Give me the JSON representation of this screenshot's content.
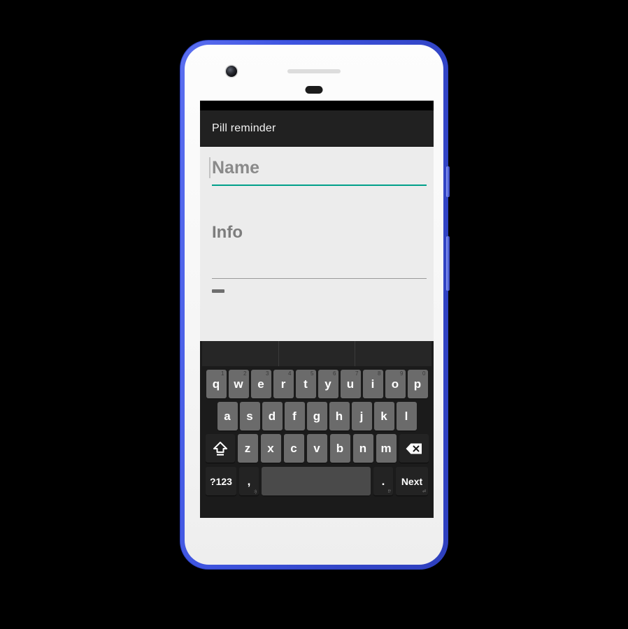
{
  "device": {
    "name": "android-phone-mockup",
    "frame_color": "#3b53d8",
    "body_color": "#f7f7f7",
    "camera": "front-camera",
    "earpiece": "earpiece-speaker",
    "sensor": "proximity-sensor"
  },
  "app": {
    "title": "Pill reminder",
    "app_bar_color": "#212121",
    "content_bg": "#ececec",
    "accent_color": "#00a08a"
  },
  "form": {
    "name_field": {
      "placeholder": "Name",
      "value": "",
      "focused": true,
      "underline_color": "#00a08a"
    },
    "info_field": {
      "placeholder": "Info",
      "value": "",
      "focused": false,
      "underline_color": "#9a9a9a"
    },
    "dash_marker": "—"
  },
  "keyboard": {
    "theme": "dark",
    "suggestions": [
      "",
      "",
      ""
    ],
    "row1": [
      {
        "label": "q",
        "num": "1"
      },
      {
        "label": "w",
        "num": "2"
      },
      {
        "label": "e",
        "num": "3"
      },
      {
        "label": "r",
        "num": "4"
      },
      {
        "label": "t",
        "num": "5"
      },
      {
        "label": "y",
        "num": "6"
      },
      {
        "label": "u",
        "num": "7"
      },
      {
        "label": "i",
        "num": "8"
      },
      {
        "label": "o",
        "num": "9"
      },
      {
        "label": "p",
        "num": "0"
      }
    ],
    "row2": [
      {
        "label": "a"
      },
      {
        "label": "s"
      },
      {
        "label": "d"
      },
      {
        "label": "f"
      },
      {
        "label": "g"
      },
      {
        "label": "h"
      },
      {
        "label": "j"
      },
      {
        "label": "k"
      },
      {
        "label": "l"
      }
    ],
    "row3": [
      {
        "label": "z"
      },
      {
        "label": "x"
      },
      {
        "label": "c"
      },
      {
        "label": "v"
      },
      {
        "label": "b"
      },
      {
        "label": "n"
      },
      {
        "label": "m"
      }
    ],
    "shift_key": "shift-icon",
    "backspace_key": "backspace-icon",
    "symbols_key": "?123",
    "comma_key": ",",
    "space_key": " ",
    "period_key": ".",
    "action_key": "Next"
  }
}
